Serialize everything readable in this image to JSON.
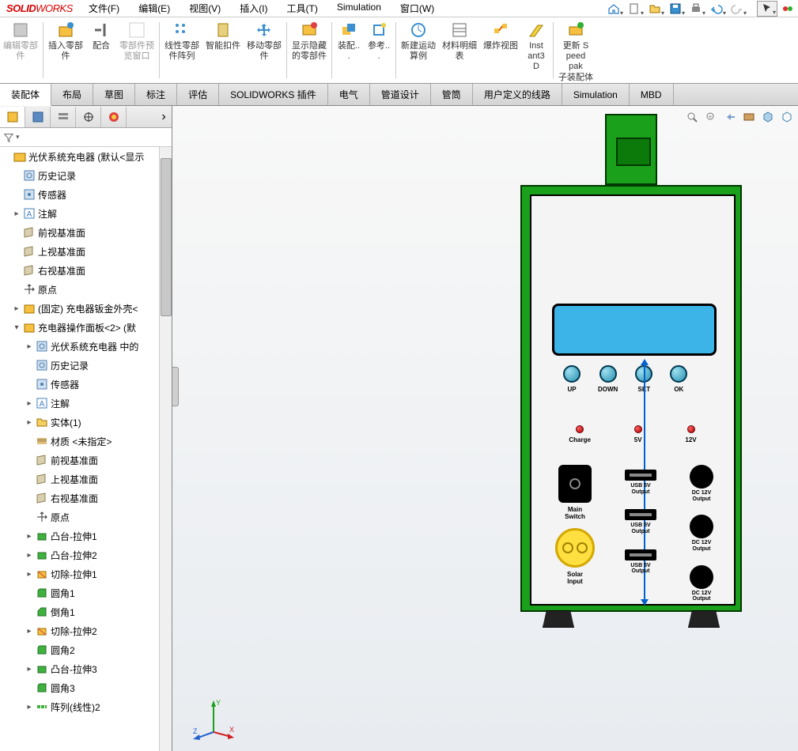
{
  "app": {
    "logo1": "SOLID",
    "logo2": "WORKS"
  },
  "menu": [
    "文件(F)",
    "编辑(E)",
    "视图(V)",
    "插入(I)",
    "工具(T)",
    "Simulation",
    "窗口(W)"
  ],
  "ribbon": [
    {
      "label": "编辑零部件",
      "icon": "edit",
      "disabled": true
    },
    {
      "label": "插入零部件",
      "icon": "insert"
    },
    {
      "label": "配合",
      "icon": "mate"
    },
    {
      "label": "零部件预览窗口",
      "icon": "preview",
      "disabled": true
    },
    {
      "label": "线性零部件阵列",
      "icon": "pattern"
    },
    {
      "label": "智能扣件",
      "icon": "smart"
    },
    {
      "label": "移动零部件",
      "icon": "move"
    },
    {
      "label": "显示隐藏的零部件",
      "icon": "showhide"
    },
    {
      "label": "装配...",
      "icon": "asm"
    },
    {
      "label": "参考...",
      "icon": "ref"
    },
    {
      "label": "新建运动算例",
      "icon": "motion"
    },
    {
      "label": "材料明细表",
      "icon": "bom"
    },
    {
      "label": "爆炸视图",
      "icon": "explode"
    },
    {
      "label": "Instant3D",
      "icon": "i3d"
    },
    {
      "label": "更新 Speedpak 子装配体",
      "icon": "speedpak"
    }
  ],
  "tabs": [
    "装配体",
    "布局",
    "草图",
    "标注",
    "评估",
    "SOLIDWORKS 插件",
    "电气",
    "管道设计",
    "管筒",
    "用户定义的线路",
    "Simulation",
    "MBD"
  ],
  "tree": [
    {
      "d": 0,
      "exp": "",
      "ic": "asm",
      "t": "光伏系统充电器  (默认<显示"
    },
    {
      "d": 1,
      "exp": "",
      "ic": "hist",
      "t": "历史记录"
    },
    {
      "d": 1,
      "exp": "",
      "ic": "sens",
      "t": "传感器"
    },
    {
      "d": 1,
      "exp": "▸",
      "ic": "ann",
      "t": "注解"
    },
    {
      "d": 1,
      "exp": "",
      "ic": "plane",
      "t": "前视基准面"
    },
    {
      "d": 1,
      "exp": "",
      "ic": "plane",
      "t": "上视基准面"
    },
    {
      "d": 1,
      "exp": "",
      "ic": "plane",
      "t": "右视基准面"
    },
    {
      "d": 1,
      "exp": "",
      "ic": "orig",
      "t": "原点"
    },
    {
      "d": 1,
      "exp": "▸",
      "ic": "part",
      "t": "(固定) 充电器钣金外壳<"
    },
    {
      "d": 1,
      "exp": "▾",
      "ic": "part",
      "t": "充电器操作面板<2> (默"
    },
    {
      "d": 2,
      "exp": "▸",
      "ic": "hist",
      "t": "光伏系统充电器 中的"
    },
    {
      "d": 2,
      "exp": "",
      "ic": "hist",
      "t": "历史记录"
    },
    {
      "d": 2,
      "exp": "",
      "ic": "sens",
      "t": "传感器"
    },
    {
      "d": 2,
      "exp": "▸",
      "ic": "ann",
      "t": "注解"
    },
    {
      "d": 2,
      "exp": "▸",
      "ic": "fold",
      "t": "实体(1)"
    },
    {
      "d": 2,
      "exp": "",
      "ic": "mat",
      "t": "材质 <未指定>"
    },
    {
      "d": 2,
      "exp": "",
      "ic": "plane",
      "t": "前视基准面"
    },
    {
      "d": 2,
      "exp": "",
      "ic": "plane",
      "t": "上视基准面"
    },
    {
      "d": 2,
      "exp": "",
      "ic": "plane",
      "t": "右视基准面"
    },
    {
      "d": 2,
      "exp": "",
      "ic": "orig",
      "t": "原点"
    },
    {
      "d": 2,
      "exp": "▸",
      "ic": "ext",
      "t": "凸台-拉伸1"
    },
    {
      "d": 2,
      "exp": "▸",
      "ic": "ext",
      "t": "凸台-拉伸2"
    },
    {
      "d": 2,
      "exp": "▸",
      "ic": "cut",
      "t": "切除-拉伸1"
    },
    {
      "d": 2,
      "exp": "",
      "ic": "fil",
      "t": "圆角1"
    },
    {
      "d": 2,
      "exp": "",
      "ic": "chm",
      "t": "倒角1"
    },
    {
      "d": 2,
      "exp": "▸",
      "ic": "cut",
      "t": "切除-拉伸2"
    },
    {
      "d": 2,
      "exp": "",
      "ic": "fil",
      "t": "圆角2"
    },
    {
      "d": 2,
      "exp": "▸",
      "ic": "ext",
      "t": "凸台-拉伸3"
    },
    {
      "d": 2,
      "exp": "",
      "ic": "fil",
      "t": "圆角3"
    },
    {
      "d": 2,
      "exp": "▸",
      "ic": "pat",
      "t": "阵列(线性)2"
    }
  ],
  "device": {
    "btns": [
      "UP",
      "DOWN",
      "SET",
      "OK"
    ],
    "leds": [
      "Charge",
      "5V",
      "12V"
    ],
    "mainswitch": "Main\nSwitch",
    "solar": "Solar\nInput",
    "usb": [
      "USB 5V\nOutput",
      "USB 5V\nOutput",
      "USB 5V\nOutput"
    ],
    "dc": [
      "DC 12V\nOutput",
      "DC 12V\nOutput",
      "DC 12V\nOutput"
    ]
  },
  "triad": {
    "x": "X",
    "y": "Y",
    "z": "Z"
  }
}
